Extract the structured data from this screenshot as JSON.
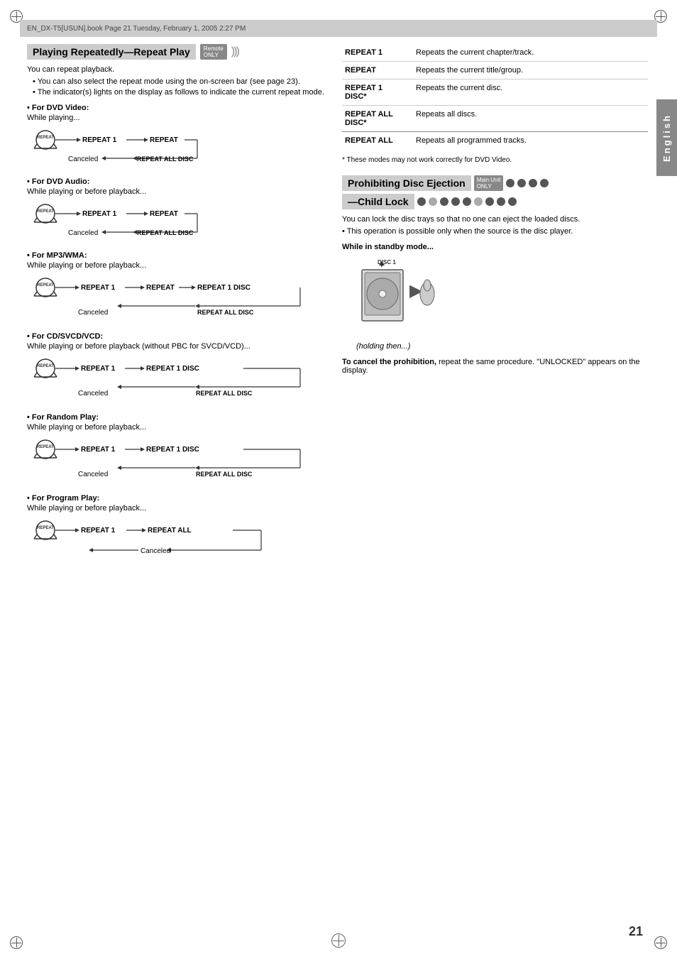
{
  "page": {
    "number": "21",
    "file_header": "EN_DX-T5[USUN].book  Page 21  Tuesday, February 1, 2005  2:27 PM",
    "english_tab": "English"
  },
  "left_section": {
    "title": "Playing Repeatedly—Repeat Play",
    "intro": "You can repeat playback.",
    "bullet1": "You can also select the repeat mode using the on-screen bar (see page 23).",
    "bullet2": "The indicator(s) lights on the display as follows to indicate the current repeat mode.",
    "dvd_video": {
      "header": "• For DVD Video:",
      "sub": "While playing..."
    },
    "dvd_audio": {
      "header": "• For DVD Audio:",
      "sub": "While playing or before playback..."
    },
    "mp3_wma": {
      "header": "• For MP3/WMA:",
      "sub": "While playing or before playback..."
    },
    "cd_svcd_vcd": {
      "header": "• For CD/SVCD/VCD:",
      "sub": "While playing or before playback (without PBC for SVCD/VCD)..."
    },
    "random": {
      "header": "• For Random Play:",
      "sub": "While playing or before playback..."
    },
    "program": {
      "header": "• For Program Play:",
      "sub": "While playing or before playback..."
    }
  },
  "right_table": {
    "rows": [
      {
        "label": "REPEAT 1",
        "desc": "Repeats the current chapter/track."
      },
      {
        "label": "REPEAT",
        "desc": "Repeats the current title/group."
      },
      {
        "label": "REPEAT 1 DISC*",
        "desc": "Repeats the current disc."
      },
      {
        "label": "REPEAT ALL DISC*",
        "desc": "Repeats all discs."
      },
      {
        "label": "REPEAT ALL",
        "desc": "Repeats all programmed tracks."
      }
    ],
    "footnote": "* These modes may not work correctly for DVD Video."
  },
  "prohibit_section": {
    "title": "Prohibiting Disc Ejection",
    "subtitle": "—Child Lock",
    "intro1": "You can lock the disc trays so that no one can eject the loaded discs.",
    "intro2": "• This operation is possible only when the source is the disc player.",
    "standby_title": "While in standby mode...",
    "holding_text": "(holding then...)",
    "disc_label": "DISC 1",
    "cancel_title": "To cancel the prohibition,",
    "cancel_desc": "repeat the same procedure. \"UNLOCKED\" appears on the display."
  },
  "flow_labels": {
    "repeat": "REPEAT",
    "repeat1": "REPEAT 1",
    "repeat_label": "REPEAT",
    "repeat1_disc": "REPEAT 1 DISC",
    "repeat_all_disc": "REPEAT ALL DISC",
    "repeat_all": "REPEAT ALL",
    "canceled": "Canceled"
  }
}
